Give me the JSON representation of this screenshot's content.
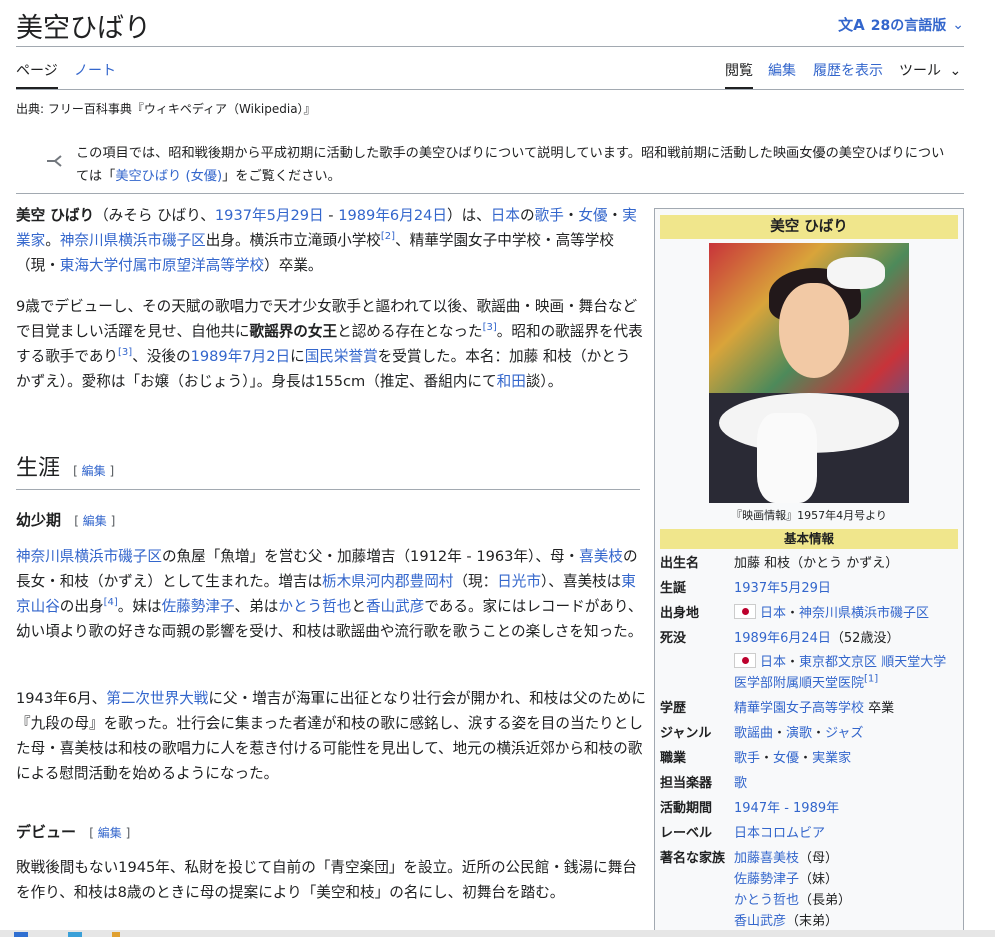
{
  "header": {
    "title": "美空ひばり",
    "lang_icon": "文A",
    "lang_label": "28の言語版",
    "lang_chevron": "⌄"
  },
  "tabs": {
    "page": "ページ",
    "note": "ノート",
    "read": "閲覧",
    "edit": "編集",
    "history": "履歴を表示",
    "tools": "ツール",
    "tools_chevron": "⌄"
  },
  "source": "出典: フリー百科事典『ウィキペディア（Wikipedia）』",
  "hatnote": {
    "pre": "この項目では、昭和戦後期から平成初期に活動した歌手の美空ひばりについて説明しています。昭和戦前期に活動した映画女優の美空ひばりについては「",
    "link": "美空ひばり (女優)",
    "post": "」をご覧ください。"
  },
  "intro": {
    "p1": {
      "name": "美空 ひばり",
      "reading": "（みそら ひばり、",
      "birth": "1937年5月29日",
      "dash": " - ",
      "death": "1989年6月24日",
      "t1": "）は、",
      "japan": "日本",
      "t2": "の",
      "singer": "歌手",
      "sep1": "・",
      "actress": "女優",
      "sep2": "・",
      "business": "実業家",
      "t3": "。",
      "place": "神奈川県横浜市磯子区",
      "t4": "出身。横浜市立滝頭小学校",
      "ref2": "[2]",
      "t5": "、精華学園女子中学校・高等学校（現・",
      "school": "東海大学付属市原望洋高等学校",
      "t6": "）卒業。"
    },
    "p2": {
      "t1": "9歳でデビューし、その天賦の歌唱力で天才少女歌手と謳われて以後、歌謡曲・映画・舞台などで目覚ましい活躍を見せ、自他共に",
      "bold": "歌謡界の女王",
      "t2": "と認める存在となった",
      "ref3a": "[3]",
      "t3": "。昭和の歌謡界を代表する歌手であり",
      "ref3b": "[3]",
      "t4": "、没後の",
      "date": "1989年7月2日",
      "t5": "に",
      "award": "国民栄誉賞",
      "t6": "を受賞した。本名：加藤 和枝（かとう かずえ）。愛称は「お嬢（おじょう）」。身長は155cm（推定、番組内にて",
      "wada": "和田",
      "t7": "談）。"
    }
  },
  "sections": {
    "career": "生涯",
    "edit_label": "編集",
    "childhood": "幼少期",
    "debut": "デビュー"
  },
  "childhood": {
    "p1": {
      "place": "神奈川県横浜市磯子区",
      "t1": "の魚屋「魚増」を営む父・加藤増吉（1912年 - 1963年）、母・",
      "mother": "喜美枝",
      "t2": "の長女・和枝（かずえ）として生まれた。増吉は",
      "tochigi": "栃木県河内郡豊岡村",
      "t3": "（現：",
      "nikko": "日光市",
      "t4": "）、喜美枝は",
      "yamakado": "東京山谷",
      "t5": "の出身",
      "ref4": "[4]",
      "t6": "。妹は",
      "sister": "佐藤勢津子",
      "t7": "、弟は",
      "bro1": "かとう哲也",
      "t8": "と",
      "bro2": "香山武彦",
      "t9": "である。家にはレコードがあり、幼い頃より歌の好きな両親の影響を受け、和枝は歌謡曲や流行歌を歌うことの楽しさを知った。"
    },
    "p2": {
      "t1": "1943年6月、",
      "war": "第二次世界大戦",
      "t2": "に父・増吉が海軍に出征となり壮行会が開かれ、和枝は父のために『九段の母』を歌った。壮行会に集まった者達が和枝の歌に感銘し、涙する姿を目の当たりとした母・喜美枝は和枝の歌唱力に人を惹き付ける可能性を見出して、地元の横浜近郊から和枝の歌による慰問活動を始めるようになった。"
    }
  },
  "debut": {
    "p1": "敗戦後間もない1945年、私財を投じて自前の「青空楽団」を設立。近所の公民館・銭湯に舞台を作り、和枝は8歳のときに母の提案により「美空和枝」の名にし、初舞台を踏む。"
  },
  "infobox": {
    "title": "美空 ひばり",
    "caption": "『映画情報』1957年4月号より",
    "header": "基本情報",
    "rows": {
      "birthname_k": "出生名",
      "birthname_v": "加藤 和枝（かとう かずえ）",
      "born_k": "生誕",
      "born_v": "1937年5月29日",
      "origin_k": "出身地",
      "origin_country": "日本",
      "origin_sep": "・",
      "origin_place": "神奈川県横浜市磯子区",
      "died_k": "死没",
      "died_date": "1989年6月24日",
      "died_age": "（52歳没）",
      "died_country": "日本",
      "died_sep1": "・",
      "died_place": "東京都文京区",
      "died_hospital": "順天堂大学医学部附属順天堂医院",
      "died_ref": "[1]",
      "edu_k": "学歴",
      "edu_v": "精華学園女子高等学校",
      "edu_suffix": " 卒業",
      "genre_k": "ジャンル",
      "genre_1": "歌謡曲",
      "genre_sep1": "・",
      "genre_2": "演歌",
      "genre_sep2": "・",
      "genre_3": "ジャズ",
      "job_k": "職業",
      "job_1": "歌手",
      "job_sep1": "・",
      "job_2": "女優",
      "job_sep2": "・",
      "job_3": "実業家",
      "inst_k": "担当楽器",
      "inst_v": "歌",
      "active_k": "活動期間",
      "active_v": "1947年 - 1989年",
      "label_k": "レーベル",
      "label_v": "日本コロムビア",
      "family_k": "著名な家族",
      "fam1": "加藤喜美枝",
      "fam1_rel": "（母）",
      "fam2": "佐藤勢津子",
      "fam2_rel": "（妹）",
      "fam3": "かとう哲也",
      "fam3_rel": "（長弟）",
      "fam4": "香山武彦",
      "fam4_rel": "（末弟）"
    }
  },
  "colors": {
    "link": "#3366cc",
    "text": "#202122",
    "infobox_header": "#f0e68c",
    "rule": "#a2a9b1"
  }
}
